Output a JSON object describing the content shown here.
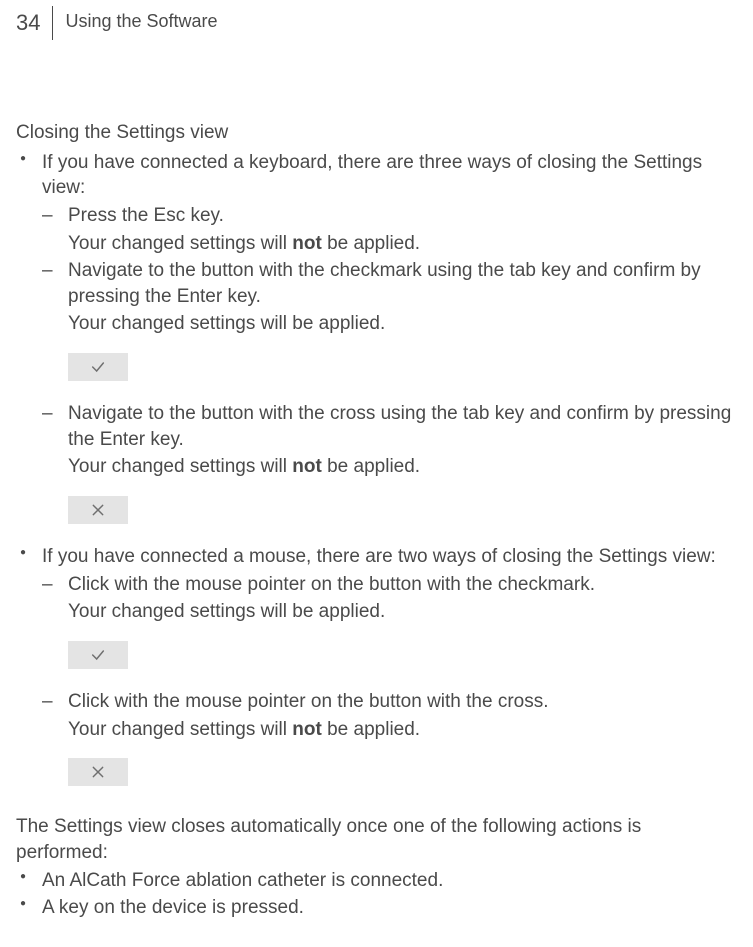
{
  "header": {
    "page_number": "34",
    "chapter": "Using the Software"
  },
  "section": {
    "title": "Closing the Settings view"
  },
  "bullets": {
    "keyboard": {
      "intro": "If you have connected a keyboard, there are three ways of closing the Settings view:",
      "items": {
        "esc": {
          "line1": "Press the Esc key.",
          "line2_a": "Your changed settings will ",
          "line2_strong": "not",
          "line2_b": " be applied."
        },
        "check": {
          "line1": "Navigate to the button with the checkmark using the tab key and confirm by pressing the Enter key.",
          "line2": "Your changed settings will be applied."
        },
        "cross": {
          "line1": "Navigate to the button with the cross using the tab key and confirm by pressing the Enter key.",
          "line2_a": "Your changed settings will ",
          "line2_strong": "not",
          "line2_b": " be applied."
        }
      }
    },
    "mouse": {
      "intro": "If you have connected a mouse, there are two ways of closing the Settings view:",
      "items": {
        "check": {
          "line1": "Click with the mouse pointer on the button with the checkmark.",
          "line2": "Your changed settings will be applied."
        },
        "cross": {
          "line1": "Click with the mouse pointer on the button with the cross.",
          "line2_a": "Your changed settings will ",
          "line2_strong": "not",
          "line2_b": " be applied."
        }
      }
    }
  },
  "auto_close": {
    "intro": "The Settings view closes automatically once one of the following actions is performed:",
    "items": [
      "An AlCath Force ablation catheter is connected.",
      "A key on the device is pressed."
    ]
  },
  "icons": {
    "check": "checkmark-icon",
    "cross": "cross-icon"
  }
}
